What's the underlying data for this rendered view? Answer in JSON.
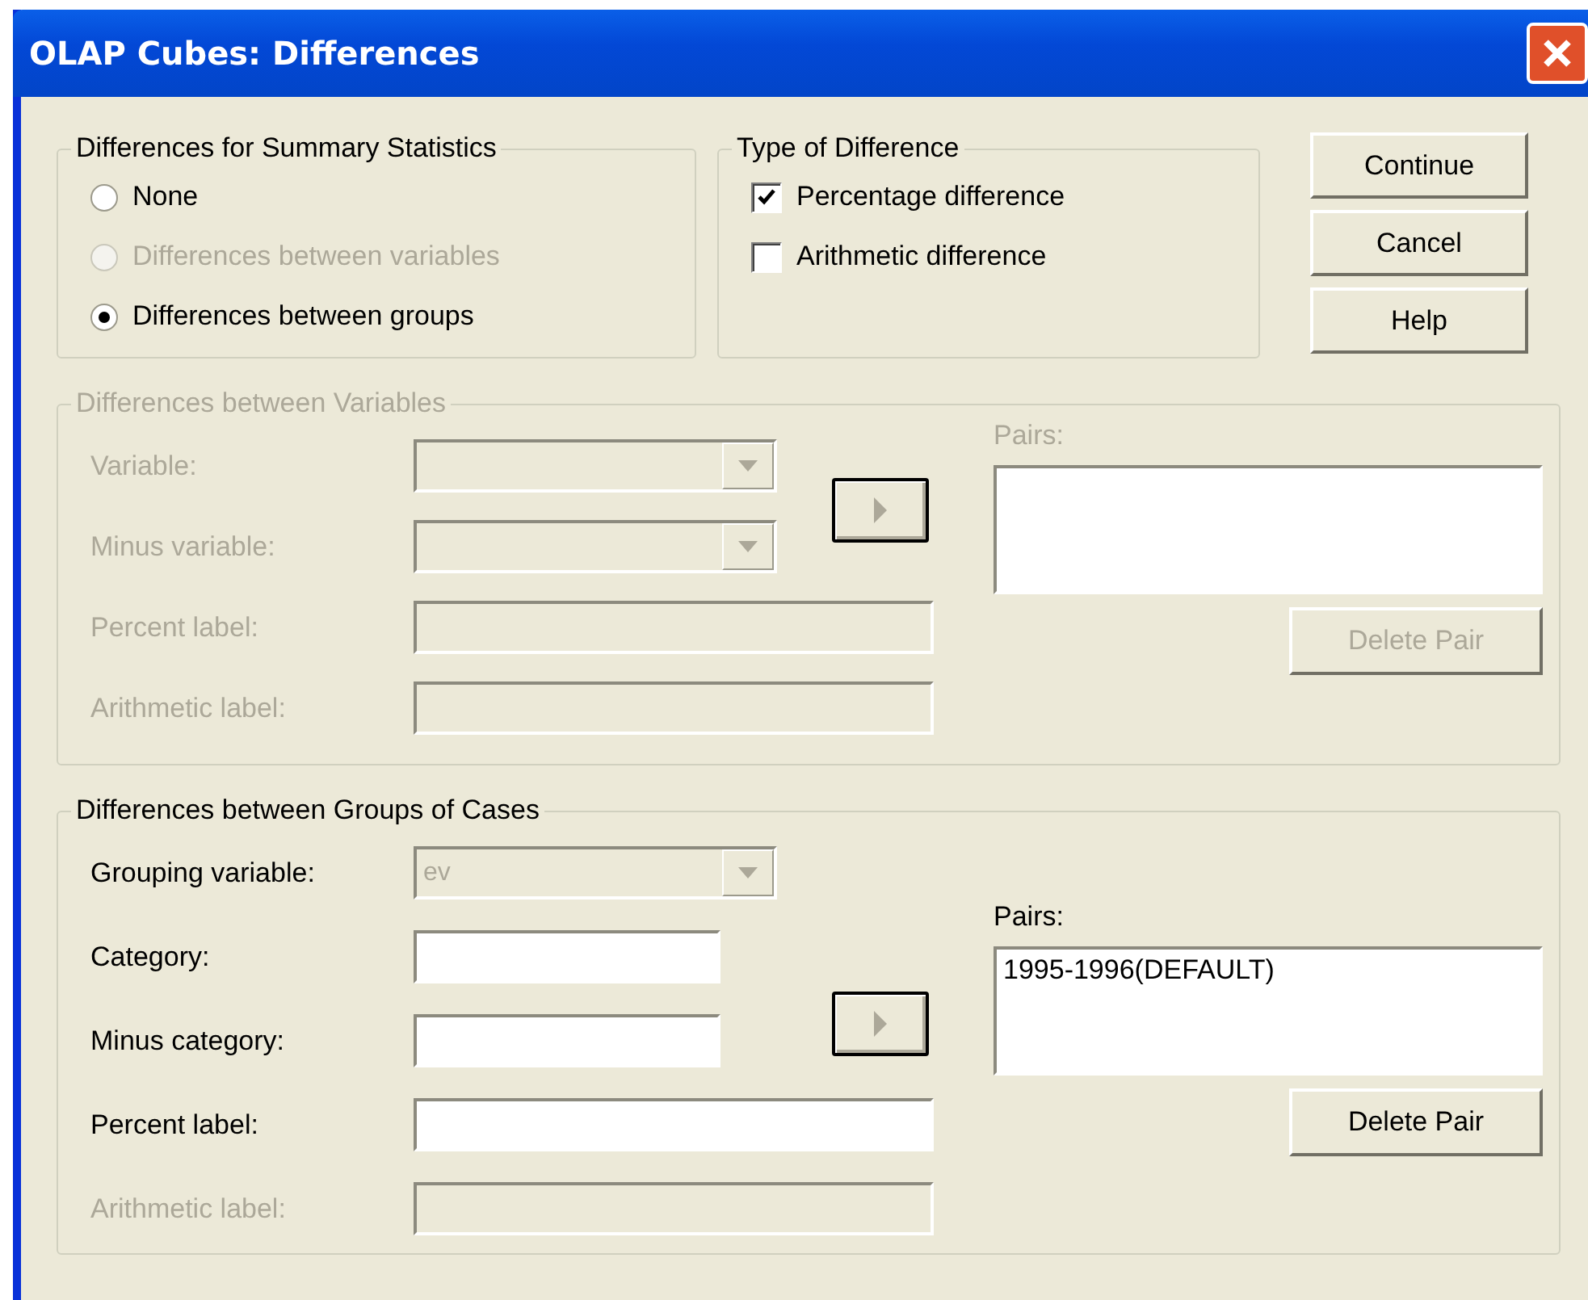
{
  "window": {
    "title": "OLAP Cubes: Differences"
  },
  "summary_statistics": {
    "title": "Differences for Summary Statistics",
    "options": [
      {
        "label": "None",
        "selected": false,
        "disabled": false
      },
      {
        "label": "Differences between variables",
        "selected": false,
        "disabled": true
      },
      {
        "label": "Differences between groups",
        "selected": true,
        "disabled": false
      }
    ]
  },
  "type_of_difference": {
    "title": "Type of Difference",
    "options": [
      {
        "label": "Percentage difference",
        "checked": true
      },
      {
        "label": "Arithmetic difference",
        "checked": false
      }
    ]
  },
  "buttons": [
    "Continue",
    "Cancel",
    "Help"
  ],
  "sections": [
    {
      "title": "Differences between Variables",
      "disabled": true,
      "fields": [
        {
          "label": "Variable:",
          "kind": "dropdown",
          "disabled": true
        },
        {
          "label": "Minus variable:",
          "kind": "dropdown",
          "disabled": true
        },
        {
          "label": "Percent label:",
          "kind": "text",
          "disabled": true
        },
        {
          "label": "Arithmetic label:",
          "kind": "text",
          "disabled": true
        }
      ],
      "pairs_label": "Pairs:",
      "delete_button": "Delete Pair"
    },
    {
      "title": "Differences between Groups of Cases",
      "disabled": false,
      "fields": [
        {
          "label": "Grouping variable:",
          "kind": "dropdown",
          "disabled": false,
          "read_only": true,
          "value": "ev"
        },
        {
          "label": "Category:",
          "kind": "short_text",
          "disabled": false
        },
        {
          "label": "Minus category:",
          "kind": "short_text",
          "disabled": false
        },
        {
          "label": "Percent label:",
          "kind": "text",
          "disabled": false
        },
        {
          "label": "Arithmetic label:",
          "kind": "text",
          "disabled": true
        }
      ],
      "pairs_label": "Pairs:",
      "pairs": [
        "1995-1996(DEFAULT)"
      ],
      "delete_button": "Delete Pair"
    }
  ]
}
